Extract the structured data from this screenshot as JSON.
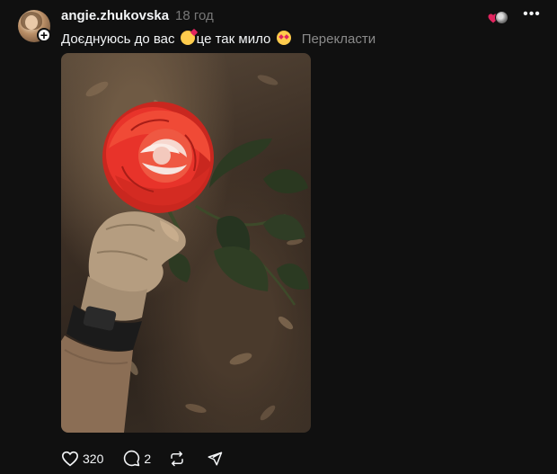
{
  "post": {
    "username": "angie.zhukovska",
    "time": "18 год",
    "caption": {
      "part1": "Доєднуюсь до вас",
      "emoji1": "smiling-face-with-hearts",
      "part2": "це так мило",
      "emoji2": "heart-eyes",
      "translate_link": "Перекласти"
    },
    "photo": {
      "subject": "hand in tactical glove holding red rose",
      "accent_color": "#e8332a"
    },
    "stats": {
      "likes": "320",
      "replies": "2"
    },
    "colors": {
      "background": "#101010",
      "text": "#f3f5f7",
      "muted": "#777777",
      "like_heart": "#e0245e"
    }
  }
}
